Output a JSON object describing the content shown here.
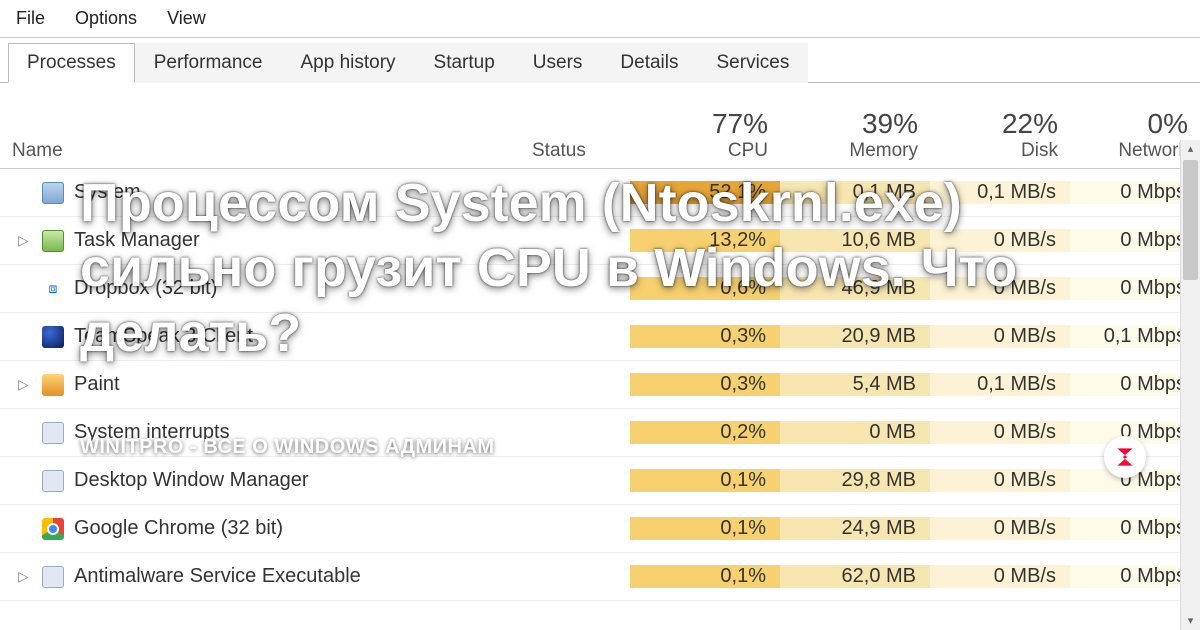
{
  "menu": {
    "file": "File",
    "options": "Options",
    "view": "View"
  },
  "tabs": [
    "Processes",
    "Performance",
    "App history",
    "Startup",
    "Users",
    "Details",
    "Services"
  ],
  "activeTab": 0,
  "columns": {
    "name": "Name",
    "status": "Status",
    "cpu": {
      "value": "77%",
      "label": "CPU"
    },
    "memory": {
      "value": "39%",
      "label": "Memory"
    },
    "disk": {
      "value": "22%",
      "label": "Disk"
    },
    "network": {
      "value": "0%",
      "label": "Network"
    }
  },
  "rows": [
    {
      "expand": "",
      "icon": "system",
      "name": "System",
      "cpu": "52,1%",
      "mem": "0,1 MB",
      "disk": "0,1 MB/s",
      "net": "0 Mbps",
      "hot": true
    },
    {
      "expand": "▷",
      "icon": "taskmgr",
      "name": "Task Manager",
      "cpu": "13,2%",
      "mem": "10,6 MB",
      "disk": "0 MB/s",
      "net": "0 Mbps"
    },
    {
      "expand": "",
      "icon": "dropbox",
      "name": "Dropbox (32 bit)",
      "cpu": "0,6%",
      "mem": "46,9 MB",
      "disk": "0 MB/s",
      "net": "0 Mbps"
    },
    {
      "expand": "",
      "icon": "ts",
      "name": "TeamSpeak 3 Client",
      "cpu": "0,3%",
      "mem": "20,9 MB",
      "disk": "0 MB/s",
      "net": "0,1 Mbps"
    },
    {
      "expand": "▷",
      "icon": "paint",
      "name": "Paint",
      "cpu": "0,3%",
      "mem": "5,4 MB",
      "disk": "0,1 MB/s",
      "net": "0 Mbps"
    },
    {
      "expand": "",
      "icon": "interrupt",
      "name": "System interrupts",
      "cpu": "0,2%",
      "mem": "0 MB",
      "disk": "0 MB/s",
      "net": "0 Mbps"
    },
    {
      "expand": "",
      "icon": "dwm",
      "name": "Desktop Window Manager",
      "cpu": "0,1%",
      "mem": "29,8 MB",
      "disk": "0 MB/s",
      "net": "0 Mbps"
    },
    {
      "expand": "",
      "icon": "chrome",
      "name": "Google Chrome (32 bit)",
      "cpu": "0,1%",
      "mem": "24,9 MB",
      "disk": "0 MB/s",
      "net": "0 Mbps"
    },
    {
      "expand": "▷",
      "icon": "generic",
      "name": "Antimalware Service Executable",
      "cpu": "0,1%",
      "mem": "62,0 MB",
      "disk": "0 MB/s",
      "net": "0 Mbps"
    }
  ],
  "overlay": {
    "title": "Процессом System (Ntoskrnl.exe) сильно грузит CPU в Windows. Что делать?",
    "subtitle": "WINITPRO - ВСЕ О WINDOWS АДМИНАМ"
  }
}
